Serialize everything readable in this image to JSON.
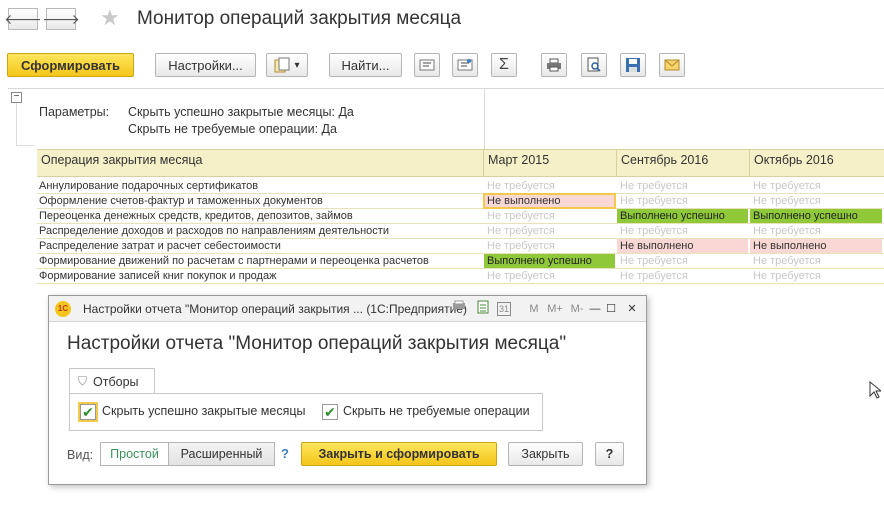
{
  "header": {
    "back_icon": "arrow-left-icon",
    "back_glyph": "🡐",
    "forward_icon": "arrow-right-icon",
    "forward_glyph": "🡒",
    "star_glyph": "★",
    "title": "Монитор операций закрытия месяца"
  },
  "toolbar": {
    "generate_label": "Сформировать",
    "settings_label": "Настройки...",
    "variant_dropdown_glyph": "▾",
    "find_label": "Найти...",
    "sum_glyph": "Σ"
  },
  "report": {
    "collapse_glyph": "−",
    "params_label": "Параметры:",
    "param1": "Скрыть успешно закрытые месяцы: Да",
    "param2": "Скрыть не требуемые операции: Да",
    "columns": [
      "Операция закрытия месяца",
      "Март 2015",
      "Сентябрь 2016",
      "Октябрь 2016"
    ],
    "rows": [
      {
        "name": "Аннулирование подарочных сертификатов",
        "v": [
          {
            "t": "Не требуется",
            "s": "nr"
          },
          {
            "t": "Не требуется",
            "s": "nr"
          },
          {
            "t": "Не требуется",
            "s": "nr"
          }
        ]
      },
      {
        "name": "Оформление счетов-фактур и таможенных документов",
        "v": [
          {
            "t": "Не выполнено",
            "s": "bad sel"
          },
          {
            "t": "Не требуется",
            "s": "nr"
          },
          {
            "t": "Не требуется",
            "s": "nr"
          }
        ]
      },
      {
        "name": "Переоценка денежных средств, кредитов, депозитов, займов",
        "v": [
          {
            "t": "Не требуется",
            "s": "nr"
          },
          {
            "t": "Выполнено успешно",
            "s": "ok"
          },
          {
            "t": "Выполнено успешно",
            "s": "ok"
          }
        ]
      },
      {
        "name": "Распределение доходов и расходов по направлениям деятельности",
        "v": [
          {
            "t": "Не требуется",
            "s": "nr"
          },
          {
            "t": "Не требуется",
            "s": "nr"
          },
          {
            "t": "Не требуется",
            "s": "nr"
          }
        ]
      },
      {
        "name": "Распределение затрат и расчет себестоимости",
        "v": [
          {
            "t": "Не требуется",
            "s": "nr"
          },
          {
            "t": "Не выполнено",
            "s": "bad"
          },
          {
            "t": "Не выполнено",
            "s": "bad"
          }
        ]
      },
      {
        "name": "Формирование движений по расчетам с партнерами и переоценка расчетов",
        "v": [
          {
            "t": "Выполнено успешно",
            "s": "ok"
          },
          {
            "t": "Не требуется",
            "s": "nr"
          },
          {
            "t": "Не требуется",
            "s": "nr"
          }
        ]
      },
      {
        "name": "Формирование записей книг покупок и продаж",
        "v": [
          {
            "t": "Не требуется",
            "s": "nr"
          },
          {
            "t": "Не требуется",
            "s": "nr"
          },
          {
            "t": "Не требуется",
            "s": "nr"
          }
        ]
      }
    ]
  },
  "dialog": {
    "logo_text": "1С",
    "window_title": "Настройки отчета \"Монитор операций закрытия ... (1С:Предприятие)",
    "heading": "Настройки отчета \"Монитор операций закрытия месяца\"",
    "tab_label": "Отборы",
    "filter_glyph": "⛉",
    "check1_label": "Скрыть успешно закрытые месяцы",
    "check2_label": "Скрыть не требуемые операции",
    "check_glyph": "✔",
    "view_label": "Вид:",
    "simple_label": "Простой",
    "advanced_label": "Расширенный",
    "help_glyph": "?",
    "close_generate_label": "Закрыть и сформировать",
    "close_label": "Закрыть",
    "help_button_label": "?",
    "bar_buttons": {
      "m": "M",
      "mplus": "M+",
      "mminus": "M-"
    },
    "bar_glyphs": {
      "calendar": "31",
      "minimize": "—",
      "maximize": "☐",
      "close": "✕"
    }
  },
  "colors": {
    "accent": "#f4c51a",
    "ok": "#8fc93a",
    "bad": "#f8d7d5",
    "header_bg": "#f5f0c8",
    "help": "#3a7ebf"
  }
}
